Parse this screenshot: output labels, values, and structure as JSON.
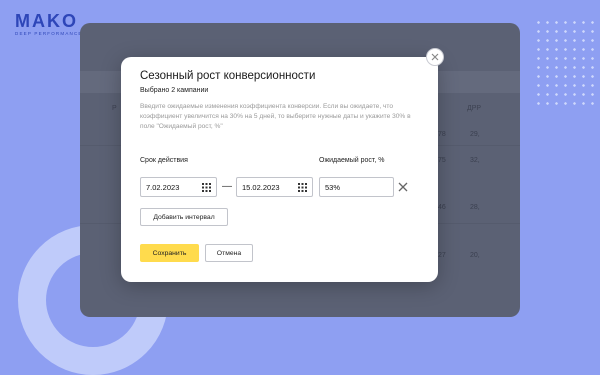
{
  "brand": {
    "name": "MAKO",
    "tagline": "DEEP PERFORMANCE"
  },
  "table": {
    "header_left": "Р",
    "header_right": "ДРР",
    "rows": [
      {
        "a": "78",
        "b": "29,"
      },
      {
        "a": "75",
        "b": "32,"
      },
      {
        "a": "46",
        "b": "28,"
      },
      {
        "a": "27",
        "b": "20,"
      }
    ]
  },
  "dialog": {
    "title": "Сезонный рост конверсионности",
    "subtitle": "Выбрано 2 кампании",
    "hint": "Введите ожидаемые изменения коэффициента конверсии. Если вы ожидаете, что коэффициент увеличится на 30% на 5 дней, то выберите нужные даты и укажите 30% в поле \"Ожидаемый рост, %\"",
    "period_label": "Срок действия",
    "growth_label": "Ожидаемый рост, %",
    "date_from": "7.02.2023",
    "date_to": "15.02.2023",
    "growth_value": "53%",
    "dash": "—",
    "add_interval": "Добавить интервал",
    "save": "Сохранить",
    "cancel": "Отмена"
  },
  "colors": {
    "accent": "#ffdb4d",
    "background": "#8e9ff2",
    "overlay": "#5b6174"
  }
}
